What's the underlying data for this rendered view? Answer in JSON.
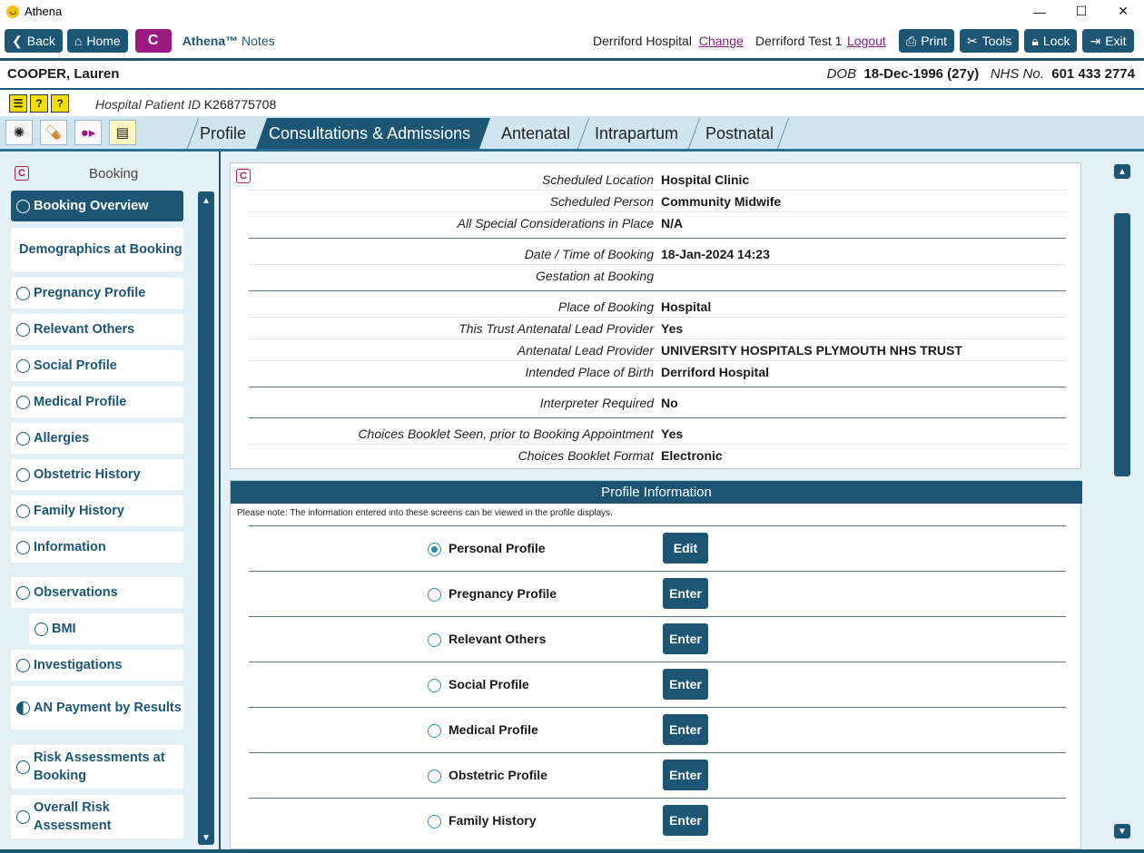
{
  "app": {
    "title": "Athena"
  },
  "toolbar": {
    "back": "Back",
    "home": "Home",
    "c_label": "C",
    "brand": "Athena™",
    "brand_sub": "Notes",
    "hospital": "Derriford Hospital",
    "change": "Change",
    "user": "Derriford Test 1",
    "logout": "Logout",
    "print": "Print",
    "tools": "Tools",
    "lock": "Lock",
    "exit": "Exit"
  },
  "patient": {
    "name": "COOPER, Lauren",
    "dob_label": "DOB",
    "dob": "18-Dec-1996 (27y)",
    "nhs_label": "NHS No.",
    "nhs": "601 433 2774",
    "hpid_label": "Hospital Patient ID",
    "hpid": "K268775708"
  },
  "tabs": [
    "Profile",
    "Consultations & Admissions",
    "Antenatal",
    "Intrapartum",
    "Postnatal"
  ],
  "sidebar": {
    "title": "Booking",
    "items": [
      {
        "label": "Booking Overview"
      },
      {
        "label": "Demographics at Booking"
      },
      {
        "label": "Pregnancy Profile"
      },
      {
        "label": "Relevant Others"
      },
      {
        "label": "Social Profile"
      },
      {
        "label": "Medical Profile"
      },
      {
        "label": "Allergies"
      },
      {
        "label": "Obstetric History"
      },
      {
        "label": "Family History"
      },
      {
        "label": "Information"
      },
      {
        "label": "Observations"
      },
      {
        "label": "BMI"
      },
      {
        "label": "Investigations"
      },
      {
        "label": "AN Payment by Results"
      },
      {
        "label": "Risk Assessments at Booking"
      },
      {
        "label": "Overall Risk Assessment"
      }
    ]
  },
  "details": [
    {
      "label": "Scheduled Location",
      "value": "Hospital Clinic"
    },
    {
      "label": "Scheduled Person",
      "value": "Community Midwife"
    },
    {
      "label": "All Special Considerations in Place",
      "value": "N/A"
    },
    {
      "label": "Date / Time of Booking",
      "value": "18-Jan-2024 14:23"
    },
    {
      "label": "Gestation at Booking",
      "value": ""
    },
    {
      "label": "Place of Booking",
      "value": "Hospital"
    },
    {
      "label": "This Trust Antenatal Lead Provider",
      "value": "Yes"
    },
    {
      "label": "Antenatal Lead Provider",
      "value": "UNIVERSITY HOSPITALS PLYMOUTH NHS TRUST"
    },
    {
      "label": "Intended Place of Birth",
      "value": "Derriford Hospital"
    },
    {
      "label": "Interpreter Required",
      "value": "No"
    },
    {
      "label": "Choices Booklet Seen, prior to Booking Appointment",
      "value": "Yes"
    },
    {
      "label": "Choices Booklet Format",
      "value": "Electronic"
    }
  ],
  "profile_info": {
    "title": "Profile Information",
    "note": "Please note: The information entered into these screens can be viewed in the profile displays.",
    "rows": [
      {
        "label": "Personal Profile",
        "button": "Edit"
      },
      {
        "label": "Pregnancy Profile",
        "button": "Enter"
      },
      {
        "label": "Relevant Others",
        "button": "Enter"
      },
      {
        "label": "Social Profile",
        "button": "Enter"
      },
      {
        "label": "Medical Profile",
        "button": "Enter"
      },
      {
        "label": "Obstetric Profile",
        "button": "Enter"
      },
      {
        "label": "Family History",
        "button": "Enter"
      }
    ]
  }
}
